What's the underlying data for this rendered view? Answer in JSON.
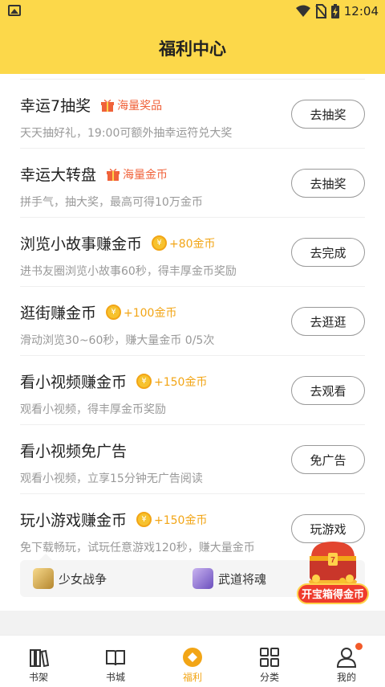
{
  "status": {
    "time": "12:04"
  },
  "header": {
    "title": "福利中心"
  },
  "tasks": [
    {
      "name": "幸运7抽奖",
      "reward": "海量奖品",
      "reward_type": "gift",
      "desc": "天天抽好礼，19:00可额外抽幸运符兑大奖",
      "button": "去抽奖"
    },
    {
      "name": "幸运大转盘",
      "reward": "海量金币",
      "reward_type": "gift",
      "desc": "拼手气，抽大奖，最高可得10万金币",
      "button": "去抽奖"
    },
    {
      "name": "浏览小故事赚金币",
      "reward": "+80金币",
      "reward_type": "coin",
      "desc": "进书友圈浏览小故事60秒，得丰厚金币奖励",
      "button": "去完成"
    },
    {
      "name": "逛街赚金币",
      "reward": "+100金币",
      "reward_type": "coin",
      "desc": "滑动浏览30~60秒，赚大量金币 0/5次",
      "button": "去逛逛"
    },
    {
      "name": "看小视频赚金币",
      "reward": "+150金币",
      "reward_type": "coin",
      "desc": "观看小视频，得丰厚金币奖励",
      "button": "去观看"
    },
    {
      "name": "看小视频免广告",
      "reward": "",
      "reward_type": "none",
      "desc": "观看小视频，立享15分钟无广告阅读",
      "button": "免广告"
    },
    {
      "name": "玩小游戏赚金币",
      "reward": "+150金币",
      "reward_type": "coin",
      "desc": "免下载畅玩，试玩任意游戏120秒，赚大量金币",
      "button": "玩游戏"
    }
  ],
  "games": [
    {
      "name": "少女战争"
    },
    {
      "name": "武道将魂"
    }
  ],
  "treasure": {
    "label": "开宝箱得金币"
  },
  "tabs": [
    {
      "label": "书架",
      "icon": "bookshelf-icon"
    },
    {
      "label": "书城",
      "icon": "book-open-icon"
    },
    {
      "label": "福利",
      "icon": "welfare-icon",
      "active": true
    },
    {
      "label": "分类",
      "icon": "grid-icon"
    },
    {
      "label": "我的",
      "icon": "user-icon",
      "badge": true
    }
  ],
  "colors": {
    "accent": "#fcd84a",
    "coin": "#f2a516",
    "gift": "#f0623a",
    "badge": "#f25a2a"
  }
}
